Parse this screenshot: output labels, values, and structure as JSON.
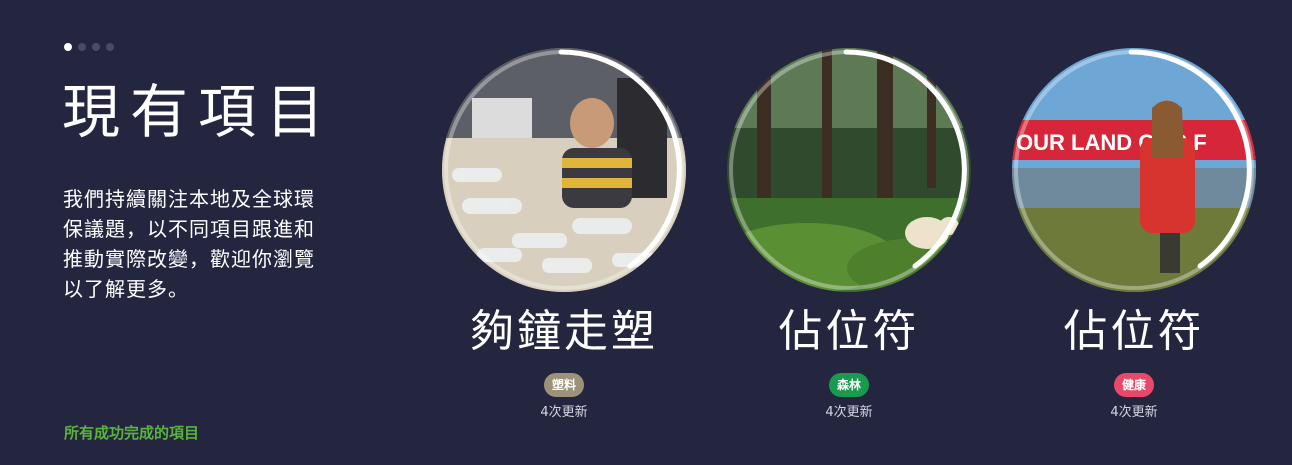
{
  "carousel": {
    "slide_count": 4,
    "active_index": 0
  },
  "header": {
    "title": "現有項目",
    "description": "我們持續關注本地及全球環保議題，以不同項目跟進和推動實際改變，歡迎你瀏覽以了解更多。"
  },
  "footer": {
    "completed_link": "所有成功完成的項目"
  },
  "projects": [
    {
      "title": "夠鐘走塑",
      "tag": "塑料",
      "tag_color": "#9c9279",
      "updates": "4次更新",
      "image": "child-with-plastic-bottles"
    },
    {
      "title": "佔位符",
      "tag": "森林",
      "tag_color": "#1a9a4d",
      "updates": "4次更新",
      "image": "spirit-bear-in-forest"
    },
    {
      "title": "佔位符",
      "tag": "健康",
      "tag_color": "#e8496b",
      "updates": "4次更新",
      "image": "activist-with-red-banner"
    }
  ],
  "banner_text": "OUR LAND OUR F"
}
